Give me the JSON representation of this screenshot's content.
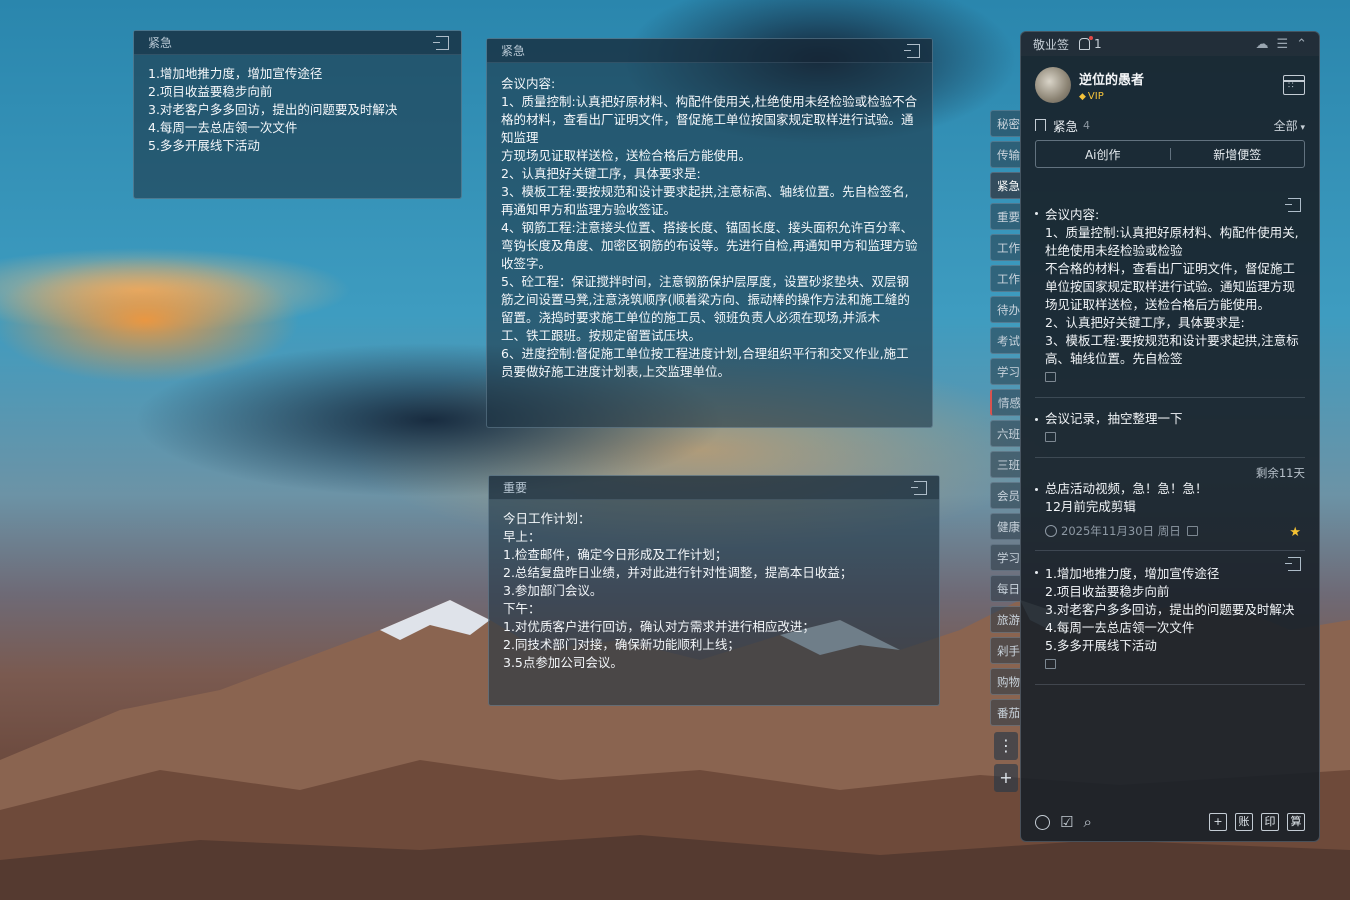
{
  "notes": {
    "n1": {
      "category": "紧急",
      "lines": [
        "1.增加地推力度，增加宣传途径",
        "2.项目收益要稳步向前",
        "3.对老客户多多回访，提出的问题要及时解决",
        "4.每周一去总店领一次文件",
        "5.多多开展线下活动"
      ]
    },
    "n2": {
      "category": "紧急",
      "lines": [
        "会议内容:",
        "1、质量控制:认真把好原材料、构配件使用关,杜绝使用未经检验或检验不合格的材料，查看出厂证明文件，督促施工单位按国家规定取样进行试验。通知监理",
        "方现场见证取样送检，送检合格后方能使用。",
        "2、认真把好关键工序，具体要求是:",
        "3、模板工程:要按规范和设计要求起拱,注意标高、轴线位置。先自检签名,再通知甲方和监理方验收签证。",
        "4、钢筋工程:注意接头位置、搭接长度、锚固长度、接头面积允许百分率、弯钩长度及角度、加密区钢筋的布设等。先进行自检,再通知甲方和监理方验收签字。",
        "5、砼工程：保证搅拌时间，注意钢筋保护层厚度，设置砂浆垫块、双层钢筋之间设置马凳,注意浇筑顺序(顺着梁方向、振动棒的操作方法和施工缝的留置。浇捣时要求施工单位的施工员、领班负责人必须在现场,并派木",
        "工、铁工跟班。按规定留置试压块。",
        "6、进度控制:督促施工单位按工程进度计划,合理组织平行和交叉作业,施工员要做好施工进度计划表,上交监理单位。"
      ]
    },
    "n3": {
      "category": "重要",
      "lines": [
        "今日工作计划：",
        "早上：",
        "1.检查邮件，确定今日形成及工作计划；",
        "2.总结复盘昨日业绩，并对此进行针对性调整，提高本日收益；",
        "3.参加部门会议。",
        "下午：",
        "1.对优质客户进行回访，确认对方需求并进行相应改进；",
        "2.同技术部门对接，确保新功能顺利上线；",
        "3.5点参加公司会议。"
      ]
    }
  },
  "side_tabs": [
    "秘密",
    "传输",
    "紧急",
    "重要",
    "工作",
    "工作",
    "待办",
    "考试",
    "学习",
    "情感",
    "六班",
    "三班",
    "会员",
    "健康",
    "学习",
    "每日",
    "旅游",
    "剁手",
    "购物",
    "番茄"
  ],
  "side_tools": [
    "⋮",
    "+"
  ],
  "panel": {
    "app_name": "敬业签",
    "notif_count": "1",
    "user_name": "逆位的愚者",
    "vip_label": "VIP",
    "category_name": "紧急",
    "category_count": "4",
    "filter_label": "全部",
    "ai_button": "Ai创作",
    "new_button": "新增便签",
    "items": [
      {
        "lines": [
          "会议内容:",
          "1、质量控制:认真把好原材料、构配件使用关,杜绝使用未经检验或检验",
          "不合格的材料，查看出厂证明文件，督促施工单位按国家规定取样进行试验。通知监理方现场见证取样送检，送检合格后方能使用。",
          "2、认真把好关键工序，具体要求是:",
          "3、模板工程:要按规范和设计要求起拱,注意标高、轴线位置。先自检签"
        ]
      },
      {
        "lines": [
          "会议记录，抽空整理一下"
        ]
      },
      {
        "remaining": "剩余11天",
        "lines": [
          "总店活动视频，急！急！急！",
          "12月前完成剪辑"
        ],
        "due": "2025年11月30日 周日"
      },
      {
        "lines": [
          "1.增加地推力度，增加宣传途径",
          "2.项目收益要稳步向前",
          "3.对老客户多多回访，提出的问题要及时解决",
          "4.每周一去总店领一次文件",
          "5.多多开展线下活动"
        ]
      }
    ],
    "footer_buttons": [
      "账",
      "印",
      "算"
    ]
  },
  "colors": {
    "accent_star": "#f5c233",
    "vip": "#f5c33b",
    "alert": "#e04848"
  }
}
